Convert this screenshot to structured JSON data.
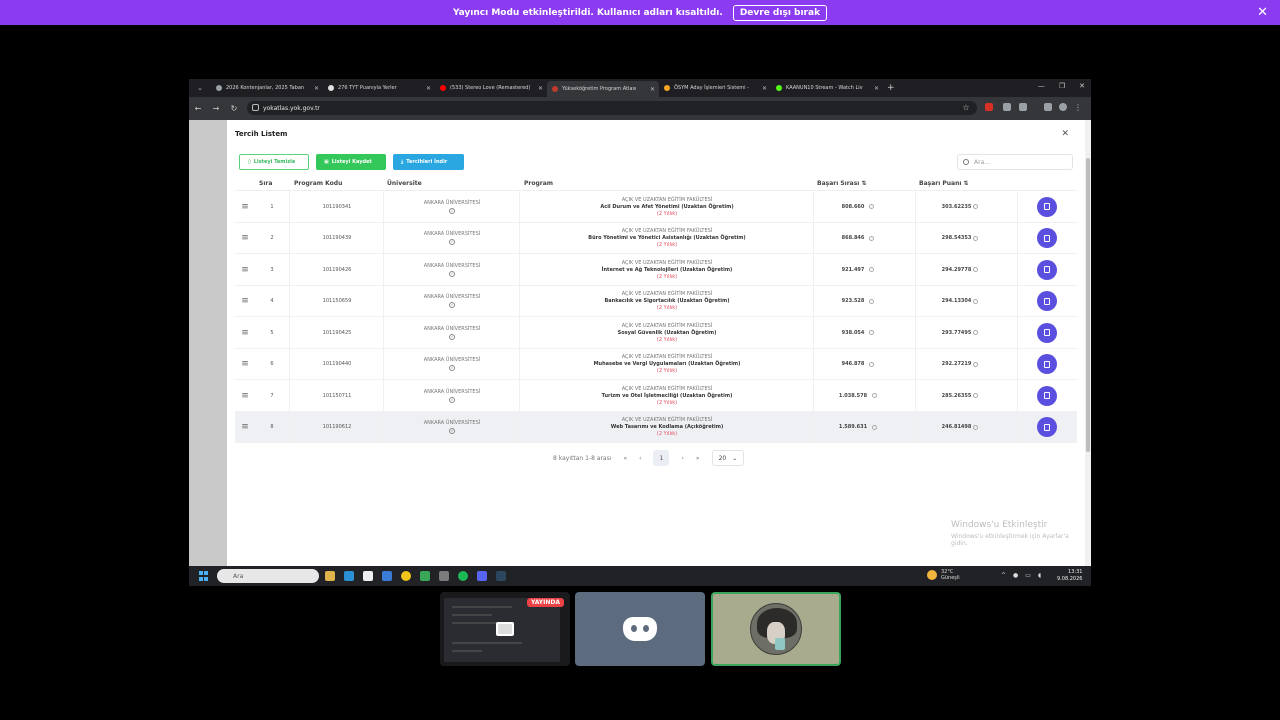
{
  "banner": {
    "message": "Yayıncı Modu etkinleştirildi. Kullanıcı adları kısaltıldı.",
    "disable_label": "Devre dışı bırak"
  },
  "browser": {
    "tabs": [
      {
        "title": "2026 Kontenjanlar, 2025 Taban",
        "fav": "#9aa0a6"
      },
      {
        "title": "276 TYT Puanıyla Yerler",
        "fav": "#e0e0e0"
      },
      {
        "title": "(533) Stereo Love (Remastered)",
        "fav": "#ff0000"
      },
      {
        "title": "Yükseköğretim Program Atlası",
        "fav": "#c0392b"
      },
      {
        "title": "ÖSYM Aday İşlemleri Sistemi -",
        "fav": "#f5a623"
      },
      {
        "title": "KAANUN10 Stream - Watch Liv",
        "fav": "#53fc18"
      }
    ],
    "active_tab": 3,
    "url": "yokatlas.yok.gov.tr"
  },
  "modal": {
    "title": "Tercih Listem",
    "buttons": {
      "clear": "Listeyi Temizle",
      "save": "Listeyi Kaydet",
      "download": "Tercihleri İndir"
    },
    "search_placeholder": "Ara...",
    "columns": {
      "sira": "Sıra",
      "code": "Program Kodu",
      "university": "Üniversite",
      "program": "Program",
      "rank": "Başarı Sırası",
      "score": "Başarı Puanı"
    },
    "rows": [
      {
        "sira": "1",
        "code": "101190341",
        "university": "ANKARA ÜNİVERSİTESİ",
        "faculty": "AÇIK VE UZAKTAN EĞİTİM FAKÜLTESİ",
        "program": "Acil Durum ve Afet Yönetimi (Uzaktan Öğretim)",
        "duration": "(2 Yıllık)",
        "rank": "808.660",
        "score": "303.62235"
      },
      {
        "sira": "2",
        "code": "101190439",
        "university": "ANKARA ÜNİVERSİTESİ",
        "faculty": "AÇIK VE UZAKTAN EĞİTİM FAKÜLTESİ",
        "program": "Büro Yönetimi ve Yönetici Asistanlığı (Uzaktan Öğretim)",
        "duration": "(2 Yıllık)",
        "rank": "868.846",
        "score": "298.54353"
      },
      {
        "sira": "3",
        "code": "101190426",
        "university": "ANKARA ÜNİVERSİTESİ",
        "faculty": "AÇIK VE UZAKTAN EĞİTİM FAKÜLTESİ",
        "program": "İnternet ve Ağ Teknolojileri (Uzaktan Öğretim)",
        "duration": "(2 Yıllık)",
        "rank": "921.497",
        "score": "294.29778"
      },
      {
        "sira": "4",
        "code": "101150659",
        "university": "ANKARA ÜNİVERSİTESİ",
        "faculty": "AÇIK VE UZAKTAN EĞİTİM FAKÜLTESİ",
        "program": "Bankacılık ve Sigortacılık (Uzaktan Öğretim)",
        "duration": "(2 Yıllık)",
        "rank": "923.528",
        "score": "294.13304"
      },
      {
        "sira": "5",
        "code": "101190425",
        "university": "ANKARA ÜNİVERSİTESİ",
        "faculty": "AÇIK VE UZAKTAN EĞİTİM FAKÜLTESİ",
        "program": "Sosyal Güvenlik (Uzaktan Öğretim)",
        "duration": "(2 Yıllık)",
        "rank": "938.054",
        "score": "293.77495"
      },
      {
        "sira": "6",
        "code": "101190440",
        "university": "ANKARA ÜNİVERSİTESİ",
        "faculty": "AÇIK VE UZAKTAN EĞİTİM FAKÜLTESİ",
        "program": "Muhasebe ve Vergi Uygulamaları (Uzaktan Öğretim)",
        "duration": "(2 Yıllık)",
        "rank": "946.878",
        "score": "292.27219"
      },
      {
        "sira": "7",
        "code": "101150711",
        "university": "ANKARA ÜNİVERSİTESİ",
        "faculty": "AÇIK VE UZAKTAN EĞİTİM FAKÜLTESİ",
        "program": "Turizm ve Otel İşletmeciliği (Uzaktan Öğretim)",
        "duration": "(2 Yıllık)",
        "rank": "1.038.578",
        "score": "285.26355"
      },
      {
        "sira": "8",
        "code": "101190612",
        "university": "ANKARA ÜNİVERSİTESİ",
        "faculty": "AÇIK VE UZAKTAN EĞİTİM FAKÜLTESİ",
        "program": "Web Tasarımı ve Kodlama (Açıköğretim)",
        "duration": "(2 Yıllık)",
        "rank": "1.589.631",
        "score": "246.81498"
      }
    ],
    "pager": {
      "summary": "8 kayıttan 1-8 arası",
      "page": "1",
      "page_size": "20"
    }
  },
  "watermark": {
    "line1": "Windows'u Etkinleştir",
    "line2": "Windows'u etkinleştirmek için Ayarlar'a gidin."
  },
  "taskbar": {
    "search_placeholder": "Ara",
    "weather_temp": "32°C",
    "weather_desc": "Güneşli",
    "time": "13:31",
    "date": "9.08.2026"
  },
  "call": {
    "live_badge": "YAYINDA"
  }
}
